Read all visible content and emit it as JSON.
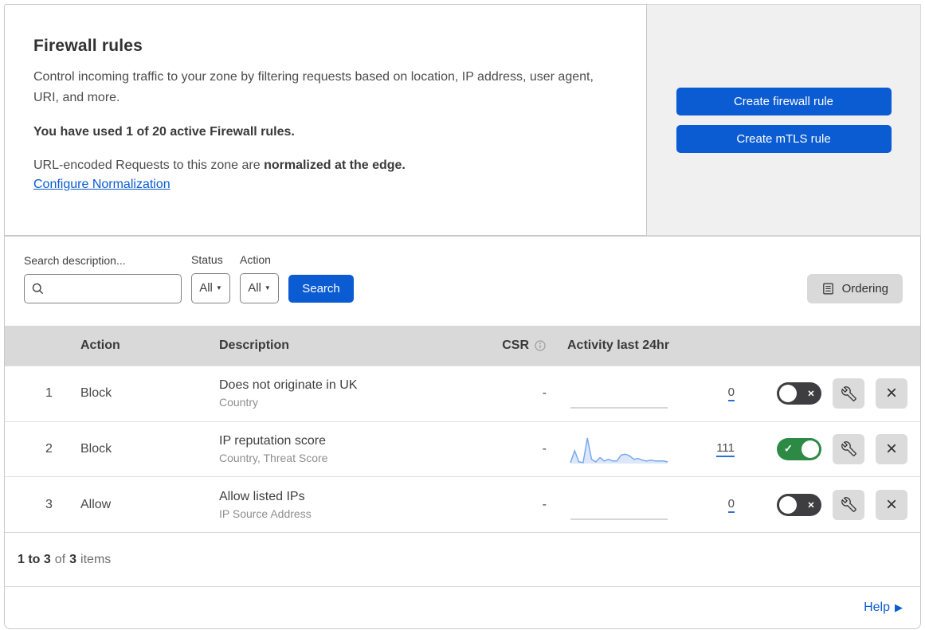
{
  "accent": {
    "blue": "#0b5bd3",
    "green": "#2d8a44",
    "toggle_off": "#3e3e40",
    "spark_line": "#7aa7f0",
    "spark_fill": "#dce8fa",
    "spark_flat": "#c9c9c9"
  },
  "icons": {
    "caret_down": "▼",
    "close": "×",
    "check": "✓",
    "toggle_cross": "×",
    "help_arrow": "▶",
    "named": [
      "search-icon",
      "ordering-list-icon",
      "info-icon",
      "wrench-icon",
      "close-icon"
    ]
  },
  "header": {
    "title": "Firewall rules",
    "description": "Control incoming traffic to your zone by filtering requests based on location, IP address, user agent, URI, and more.",
    "usage_bold": "You have used 1 of 20 active Firewall rules.",
    "normalization_prefix": "URL-encoded Requests to this zone are ",
    "normalization_bold": "normalized at the edge.",
    "normalization_link": "Configure Normalization",
    "create_firewall_button": "Create firewall rule",
    "create_mtls_button": "Create mTLS rule"
  },
  "filters": {
    "search_label": "Search description...",
    "search_value": "",
    "status_label": "Status",
    "status_value": "All",
    "action_label": "Action",
    "action_value": "All",
    "search_button": "Search",
    "ordering_button": "Ordering"
  },
  "table": {
    "headers": {
      "action": "Action",
      "description": "Description",
      "csr": "CSR",
      "activity": "Activity last 24hr"
    },
    "rows": [
      {
        "index": "1",
        "action": "Block",
        "description": "Does not originate in UK",
        "fields": "Country",
        "csr": "-",
        "count": "0",
        "enabled": false,
        "sparkline": [
          0,
          0,
          0,
          0,
          0,
          0,
          0,
          0,
          0,
          0,
          0,
          0
        ]
      },
      {
        "index": "2",
        "action": "Block",
        "description": "IP reputation score",
        "fields": "Country, Threat Score",
        "csr": "-",
        "count": "111",
        "enabled": true,
        "sparkline": [
          1,
          15,
          2,
          1,
          30,
          5,
          2,
          7,
          3,
          5,
          3,
          3,
          10,
          11,
          9,
          5,
          6,
          4,
          3,
          4,
          3,
          3,
          3,
          2
        ]
      },
      {
        "index": "3",
        "action": "Allow",
        "description": "Allow listed IPs",
        "fields": "IP Source Address",
        "csr": "-",
        "count": "0",
        "enabled": false,
        "sparkline": [
          0,
          0,
          0,
          0,
          0,
          0,
          0,
          0,
          0,
          0,
          0,
          0
        ]
      }
    ]
  },
  "footer": {
    "range_bold": "1 to 3",
    "of_text": "of",
    "total_bold": "3",
    "items_text": "items",
    "help_link": "Help"
  }
}
